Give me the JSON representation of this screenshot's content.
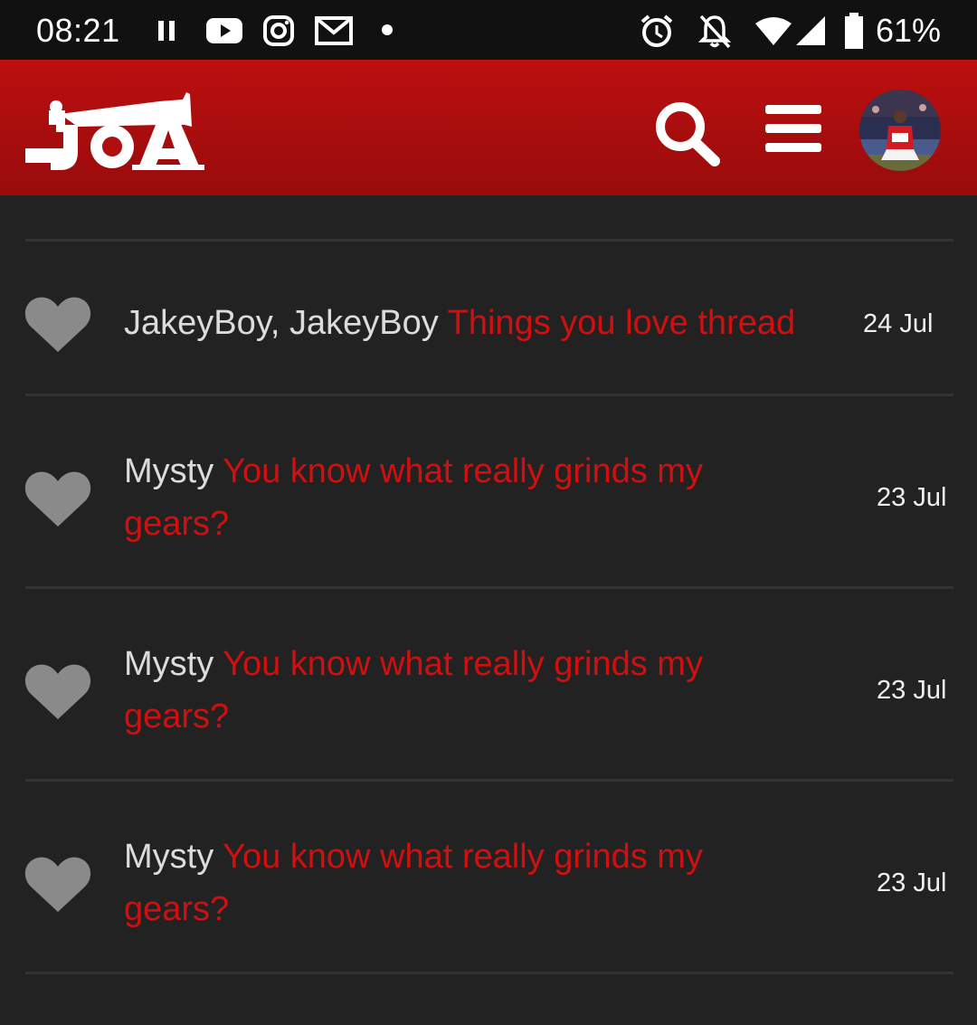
{
  "status_bar": {
    "time": "08:21",
    "battery": "61%",
    "left_icons": [
      "pause-icon",
      "youtube-icon",
      "instagram-icon",
      "gmail-icon",
      "dot-icon"
    ],
    "right_icons": [
      "alarm-icon",
      "notifications-off-icon",
      "wifi-icon",
      "signal-icon",
      "battery-icon"
    ]
  },
  "header": {
    "logo_text": "OA",
    "search_icon": "search-icon",
    "menu_icon": "menu-icon",
    "avatar": "user-avatar",
    "colors": {
      "brand": "#b00e0f",
      "icon": "#ffffff"
    }
  },
  "alerts": [
    {
      "user": "JakeyBoy, JakeyBoy",
      "thread": "Things you love thread",
      "date": "24 Jul",
      "icon": "heart-icon"
    },
    {
      "user": "Mysty",
      "thread": "You know what really grinds my gears?",
      "date": "23 Jul",
      "icon": "heart-icon"
    },
    {
      "user": "Mysty",
      "thread": "You know what really grinds my gears?",
      "date": "23 Jul",
      "icon": "heart-icon"
    },
    {
      "user": "Mysty",
      "thread": "You know what really grinds my gears?",
      "date": "23 Jul",
      "icon": "heart-icon"
    }
  ],
  "colors": {
    "background": "#222222",
    "link": "#d01010",
    "text": "#dcdcdc",
    "heart": "#8a8a8a",
    "divider": "#333333"
  }
}
